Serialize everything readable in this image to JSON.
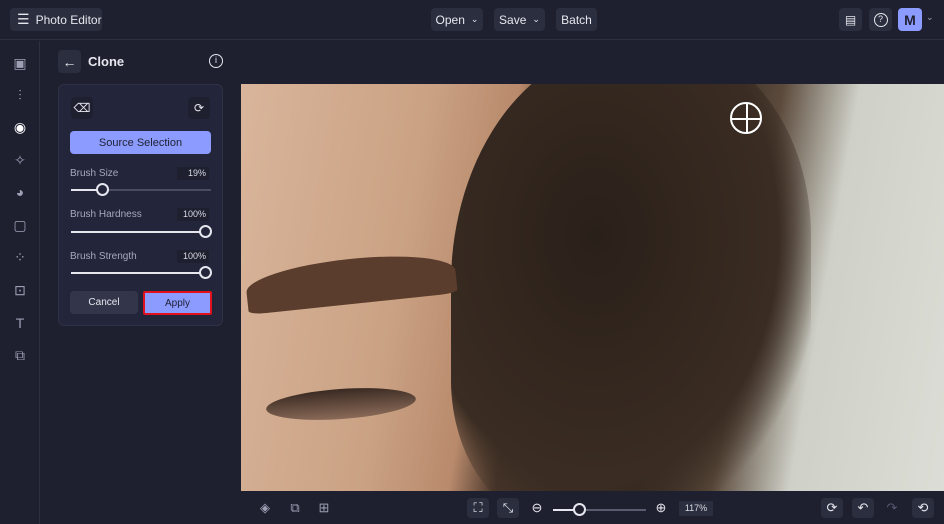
{
  "header": {
    "app_title": "Photo Editor",
    "open_label": "Open",
    "save_label": "Save",
    "batch_label": "Batch",
    "avatar_initial": "M"
  },
  "panel": {
    "title": "Clone",
    "source_selection_label": "Source Selection",
    "sliders": [
      {
        "label": "Brush Size",
        "value_text": "19%",
        "value": 19
      },
      {
        "label": "Brush Hardness",
        "value_text": "100%",
        "value": 100
      },
      {
        "label": "Brush Strength",
        "value_text": "100%",
        "value": 100
      }
    ],
    "cancel_label": "Cancel",
    "apply_label": "Apply"
  },
  "bottom": {
    "zoom_text": "117%",
    "zoom_value": 0.17
  },
  "colors": {
    "accent": "#8c9bff",
    "highlight": "#e0101c"
  }
}
